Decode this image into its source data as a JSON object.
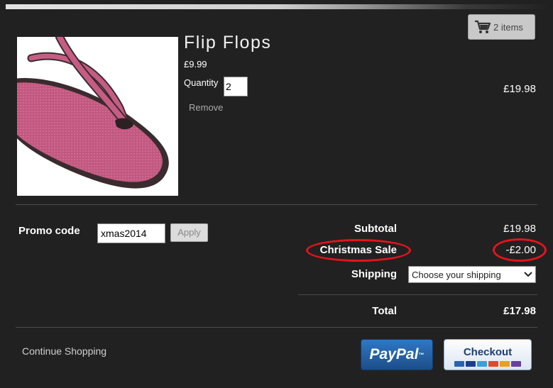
{
  "cart": {
    "label": "2 items"
  },
  "product": {
    "name": "Flip Flops",
    "unit_price": "£9.99",
    "quantity_label": "Quantity",
    "quantity": "2",
    "remove_label": "Remove",
    "line_total": "£19.98"
  },
  "promo": {
    "label": "Promo code",
    "code": "xmas2014",
    "apply_label": "Apply"
  },
  "summary": {
    "subtotal_label": "Subtotal",
    "subtotal_value": "£19.98",
    "discount_label": "Christmas Sale",
    "discount_value": "-£2.00",
    "shipping_label": "Shipping",
    "shipping_selected": "Choose your shipping",
    "total_label": "Total",
    "total_value": "£17.98"
  },
  "actions": {
    "continue_label": "Continue Shopping",
    "paypal_label": "PayPal",
    "paypal_tm": "™",
    "checkout_label": "Checkout"
  },
  "colors": {
    "background": "#222121",
    "highlight": "#e3141d"
  }
}
